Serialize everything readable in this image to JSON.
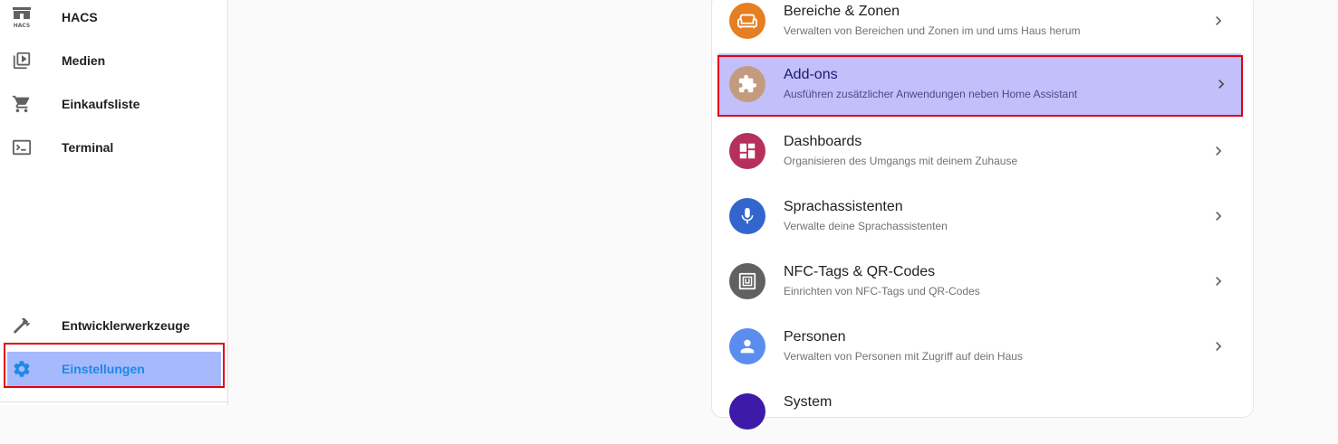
{
  "sidebar": {
    "items": [
      {
        "label": "HACS",
        "icon": "hacs-icon"
      },
      {
        "label": "Medien",
        "icon": "media-icon"
      },
      {
        "label": "Einkaufsliste",
        "icon": "cart-icon"
      },
      {
        "label": "Terminal",
        "icon": "terminal-icon"
      },
      {
        "label": "Entwicklerwerkzeuge",
        "icon": "hammer-icon"
      },
      {
        "label": "Einstellungen",
        "icon": "gear-icon"
      }
    ],
    "hacs_icon_text": "HACS"
  },
  "settings": {
    "rows": [
      {
        "title": "Bereiche & Zonen",
        "subtitle": "Verwalten von Bereichen und Zonen im und ums Haus herum",
        "color": "#e67e22",
        "icon": "sofa-icon"
      },
      {
        "title": "Add-ons",
        "subtitle": "Ausführen zusätzlicher Anwendungen neben Home Assistant",
        "color": "#c39b7e",
        "icon": "puzzle-icon"
      },
      {
        "title": "Dashboards",
        "subtitle": "Organisieren des Umgangs mit deinem Zuhause",
        "color": "#b5305a",
        "icon": "dashboard-icon"
      },
      {
        "title": "Sprachassistenten",
        "subtitle": "Verwalte deine Sprachassistenten",
        "color": "#3366cc",
        "icon": "microphone-icon"
      },
      {
        "title": "NFC-Tags & QR-Codes",
        "subtitle": "Einrichten von NFC-Tags und QR-Codes",
        "color": "#616161",
        "icon": "nfc-icon"
      },
      {
        "title": "Personen",
        "subtitle": "Verwalten von Personen mit Zugriff auf dein Haus",
        "color": "#5b8def",
        "icon": "person-icon"
      },
      {
        "title": "System",
        "subtitle": "",
        "color": "#3d1aa8",
        "icon": "system-icon"
      }
    ]
  },
  "colors": {
    "highlight": "#e3000f",
    "active_bg": "#a6b9fc",
    "active_text": "#1e88e5",
    "selected_row_bg": "#c2bffb"
  }
}
